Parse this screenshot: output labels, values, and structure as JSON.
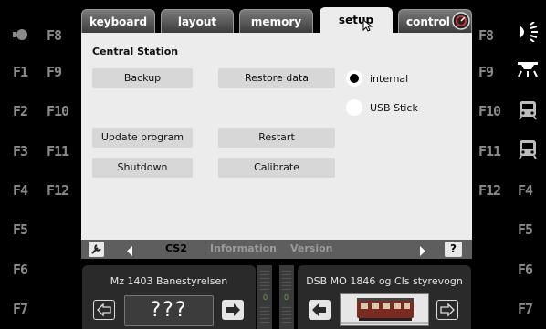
{
  "tabs": [
    {
      "label": "keyboard"
    },
    {
      "label": "layout"
    },
    {
      "label": "memory"
    },
    {
      "label": "setup"
    },
    {
      "label": "control"
    }
  ],
  "left_fkeys": {
    "col1": [
      "F1",
      "F2",
      "F3",
      "F4",
      "F5",
      "F6",
      "F7"
    ],
    "col2": [
      "F8",
      "F9",
      "F10",
      "F11",
      "F12"
    ]
  },
  "right_fkeys": {
    "col1": [
      "F8",
      "F9",
      "F10",
      "F11",
      "F12"
    ],
    "col2": [
      "F4",
      "F5",
      "F6",
      "F7"
    ]
  },
  "panel": {
    "title": "Central Station",
    "buttons": {
      "backup": "Backup",
      "restore": "Restore data",
      "update": "Update program",
      "restart": "Restart",
      "shutdown": "Shutdown",
      "calibrate": "Calibrate"
    },
    "storage": {
      "internal": "internal",
      "usb": "USB Stick",
      "selected": "internal"
    }
  },
  "bottom_bar": {
    "cs2": "CS2",
    "information": "Information",
    "version": "Version",
    "help": "?"
  },
  "locos": {
    "left": {
      "name": "Mz 1403 Banestyrelsen",
      "display": "???",
      "speed": "0"
    },
    "right": {
      "name": "DSB MO 1846 og Cls styrevogn",
      "speed": "0"
    }
  },
  "colors": {
    "accent_green": "#6ba04a",
    "panel_bg": "#ececec",
    "button_bg": "#d7d7d7"
  }
}
